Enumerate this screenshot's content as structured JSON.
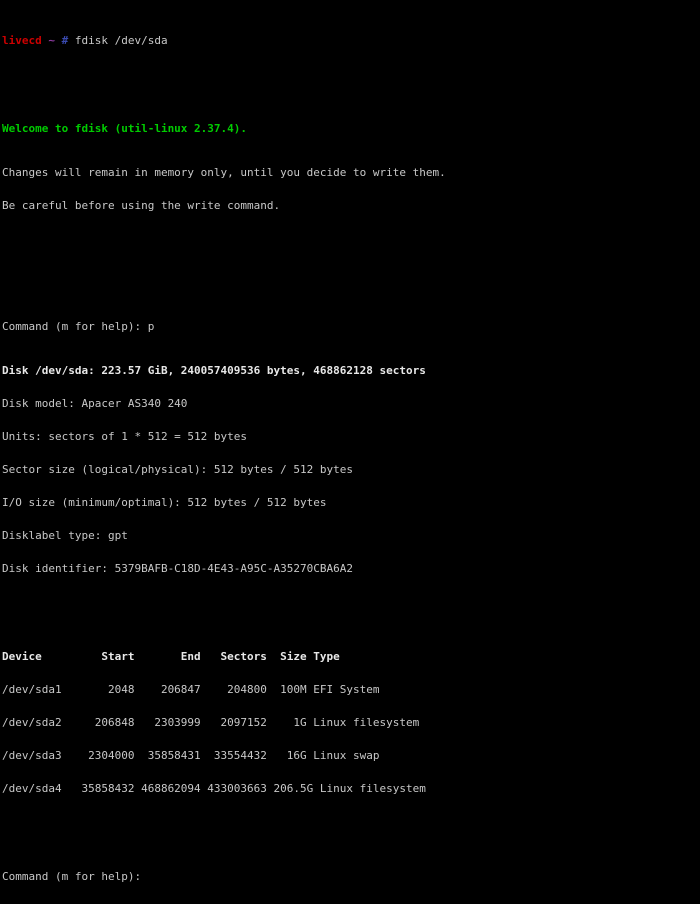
{
  "terminal": {
    "background_color": "#000000",
    "foreground_color": "#c8c8c8",
    "prompt": {
      "host": "livecd",
      "host_color": "#cc0000",
      "path": "~",
      "path_color": "#8b3a9e",
      "symbol": "#",
      "symbol_color": "#3a4ab0",
      "command": "fdisk /dev/sda"
    },
    "welcome": {
      "text": "Welcome to fdisk (util-linux 2.37.4).",
      "color": "#00cc00"
    },
    "notices": [
      "Changes will remain in memory only, until you decide to write them.",
      "Be careful before using the write command."
    ],
    "command_prompt_label": "Command (m for help): ",
    "command_entered": "p",
    "disk_info": [
      "Disk /dev/sda: 223.57 GiB, 240057409536 bytes, 468862128 sectors",
      "Disk model: Apacer AS340 240",
      "Units: sectors of 1 * 512 = 512 bytes",
      "Sector size (logical/physical): 512 bytes / 512 bytes",
      "I/O size (minimum/optimal): 512 bytes / 512 bytes",
      "Disklabel type: gpt",
      "Disk identifier: 5379BAFB-C18D-4E43-A95C-A35270CBA6A2"
    ],
    "disk_summary": {
      "device": "/dev/sda",
      "size_human": "223.57 GiB",
      "size_bytes": "240057409536",
      "sectors": "468862128",
      "model": "Apacer AS340 240",
      "units": "sectors of 1 * 512 = 512 bytes",
      "sector_size": "512 bytes / 512 bytes",
      "io_size": "512 bytes / 512 bytes",
      "disklabel_type": "gpt",
      "disk_identifier": "5379BAFB-C18D-4E43-A95C-A35270CBA6A2"
    },
    "partition_table": {
      "headers": [
        "Device",
        "Start",
        "End",
        "Sectors",
        "Size",
        "Type"
      ],
      "header_line": "Device         Start       End   Sectors  Size Type",
      "rows": [
        {
          "line": "/dev/sda1       2048    206847    204800  100M EFI System",
          "device": "/dev/sda1",
          "start": "2048",
          "end": "206847",
          "sectors": "204800",
          "size": "100M",
          "type": "EFI System"
        },
        {
          "line": "/dev/sda2     206848   2303999   2097152    1G Linux filesystem",
          "device": "/dev/sda2",
          "start": "206848",
          "end": "2303999",
          "sectors": "2097152",
          "size": "1G",
          "type": "Linux filesystem"
        },
        {
          "line": "/dev/sda3    2304000  35858431  33554432   16G Linux swap",
          "device": "/dev/sda3",
          "start": "2304000",
          "end": "35858431",
          "sectors": "33554432",
          "size": "16G",
          "type": "Linux swap"
        },
        {
          "line": "/dev/sda4   35858432 468862094 433003663 206.5G Linux filesystem",
          "device": "/dev/sda4",
          "start": "35858432",
          "end": "468862094",
          "sectors": "433003663",
          "size": "206.5G",
          "type": "Linux filesystem"
        }
      ]
    },
    "final_prompt_label": "Command (m for help): "
  }
}
